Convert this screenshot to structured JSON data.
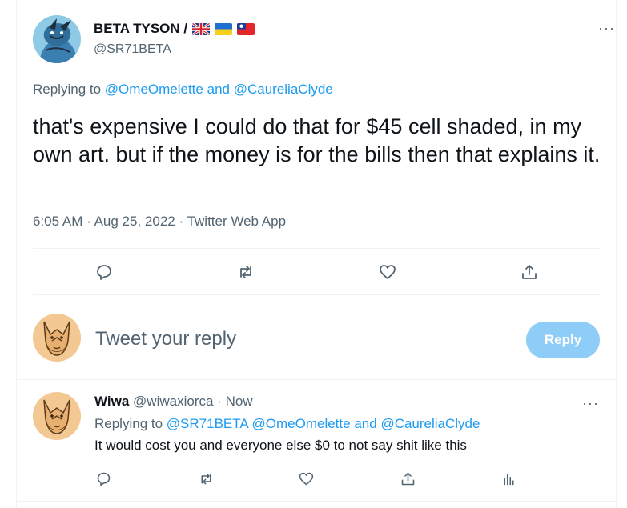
{
  "main_tweet": {
    "author_name": "BETA TYSON /",
    "handle": "@SR71BETA",
    "flags": [
      "united-kingdom-flag-icon",
      "ukraine-flag-icon",
      "taiwan-flag-icon"
    ],
    "replying_prefix": "Replying to",
    "replying_to_1": "@OmeOmelette",
    "replying_and": "and",
    "replying_to_2": "@CaureliaClyde",
    "text": "that's expensive I could do that for $45 cell shaded, in my own art. but if the money is for the bills then that explains it.",
    "time": "6:05 AM",
    "sep": "·",
    "date": "Aug 25, 2022",
    "source": "Twitter Web App",
    "more": "···"
  },
  "composer": {
    "placeholder": "Tweet your reply",
    "reply_label": "Reply"
  },
  "reply_tweet": {
    "author_name": "Wiwa",
    "handle": "@wiwaxiorca",
    "sep": "·",
    "time": "Now",
    "replying_prefix": "Replying to",
    "replying_to_1": "@SR71BETA",
    "replying_to_2": "@OmeOmelette",
    "replying_and": "and",
    "replying_to_3": "@CaureliaClyde",
    "text": "It would cost you and everyone else $0 to not say shit like this",
    "more": "···"
  },
  "colors": {
    "accent": "#1d9bf0",
    "reply_button_disabled": "#8ecdf8",
    "secondary_text": "#536471",
    "divider": "#eff3f4"
  }
}
